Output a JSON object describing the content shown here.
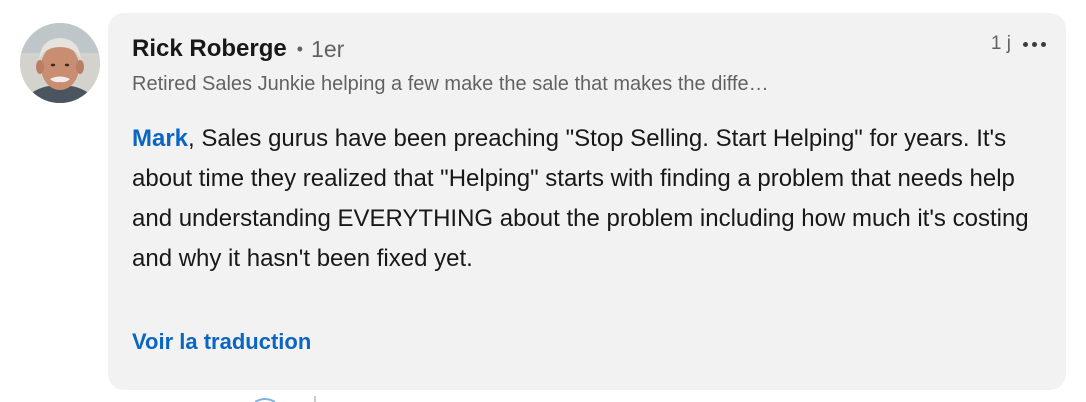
{
  "comment": {
    "author_name": "Rick Roberge",
    "bullet": "•",
    "connection_degree": "1er",
    "timestamp": "1 j",
    "headline": "Retired Sales Junkie helping a few make the sale that makes the diffe…",
    "mention": "Mark",
    "body": ", Sales gurus have been preaching \"Stop Selling. Start Helping\" for years. It's about time they realized that \"Helping\" starts with finding a problem that needs help and understanding EVERYTHING about the problem including how much it's costing and why it hasn't been fixed yet.",
    "see_translation": "Voir la traduction",
    "more_icon": "ellipsis-horizontal-icon"
  },
  "colors": {
    "bubble_bg": "#f2f2f2",
    "link_blue": "#0a66c2",
    "secondary_text": "#666666",
    "primary_text": "#1a1a1a"
  }
}
